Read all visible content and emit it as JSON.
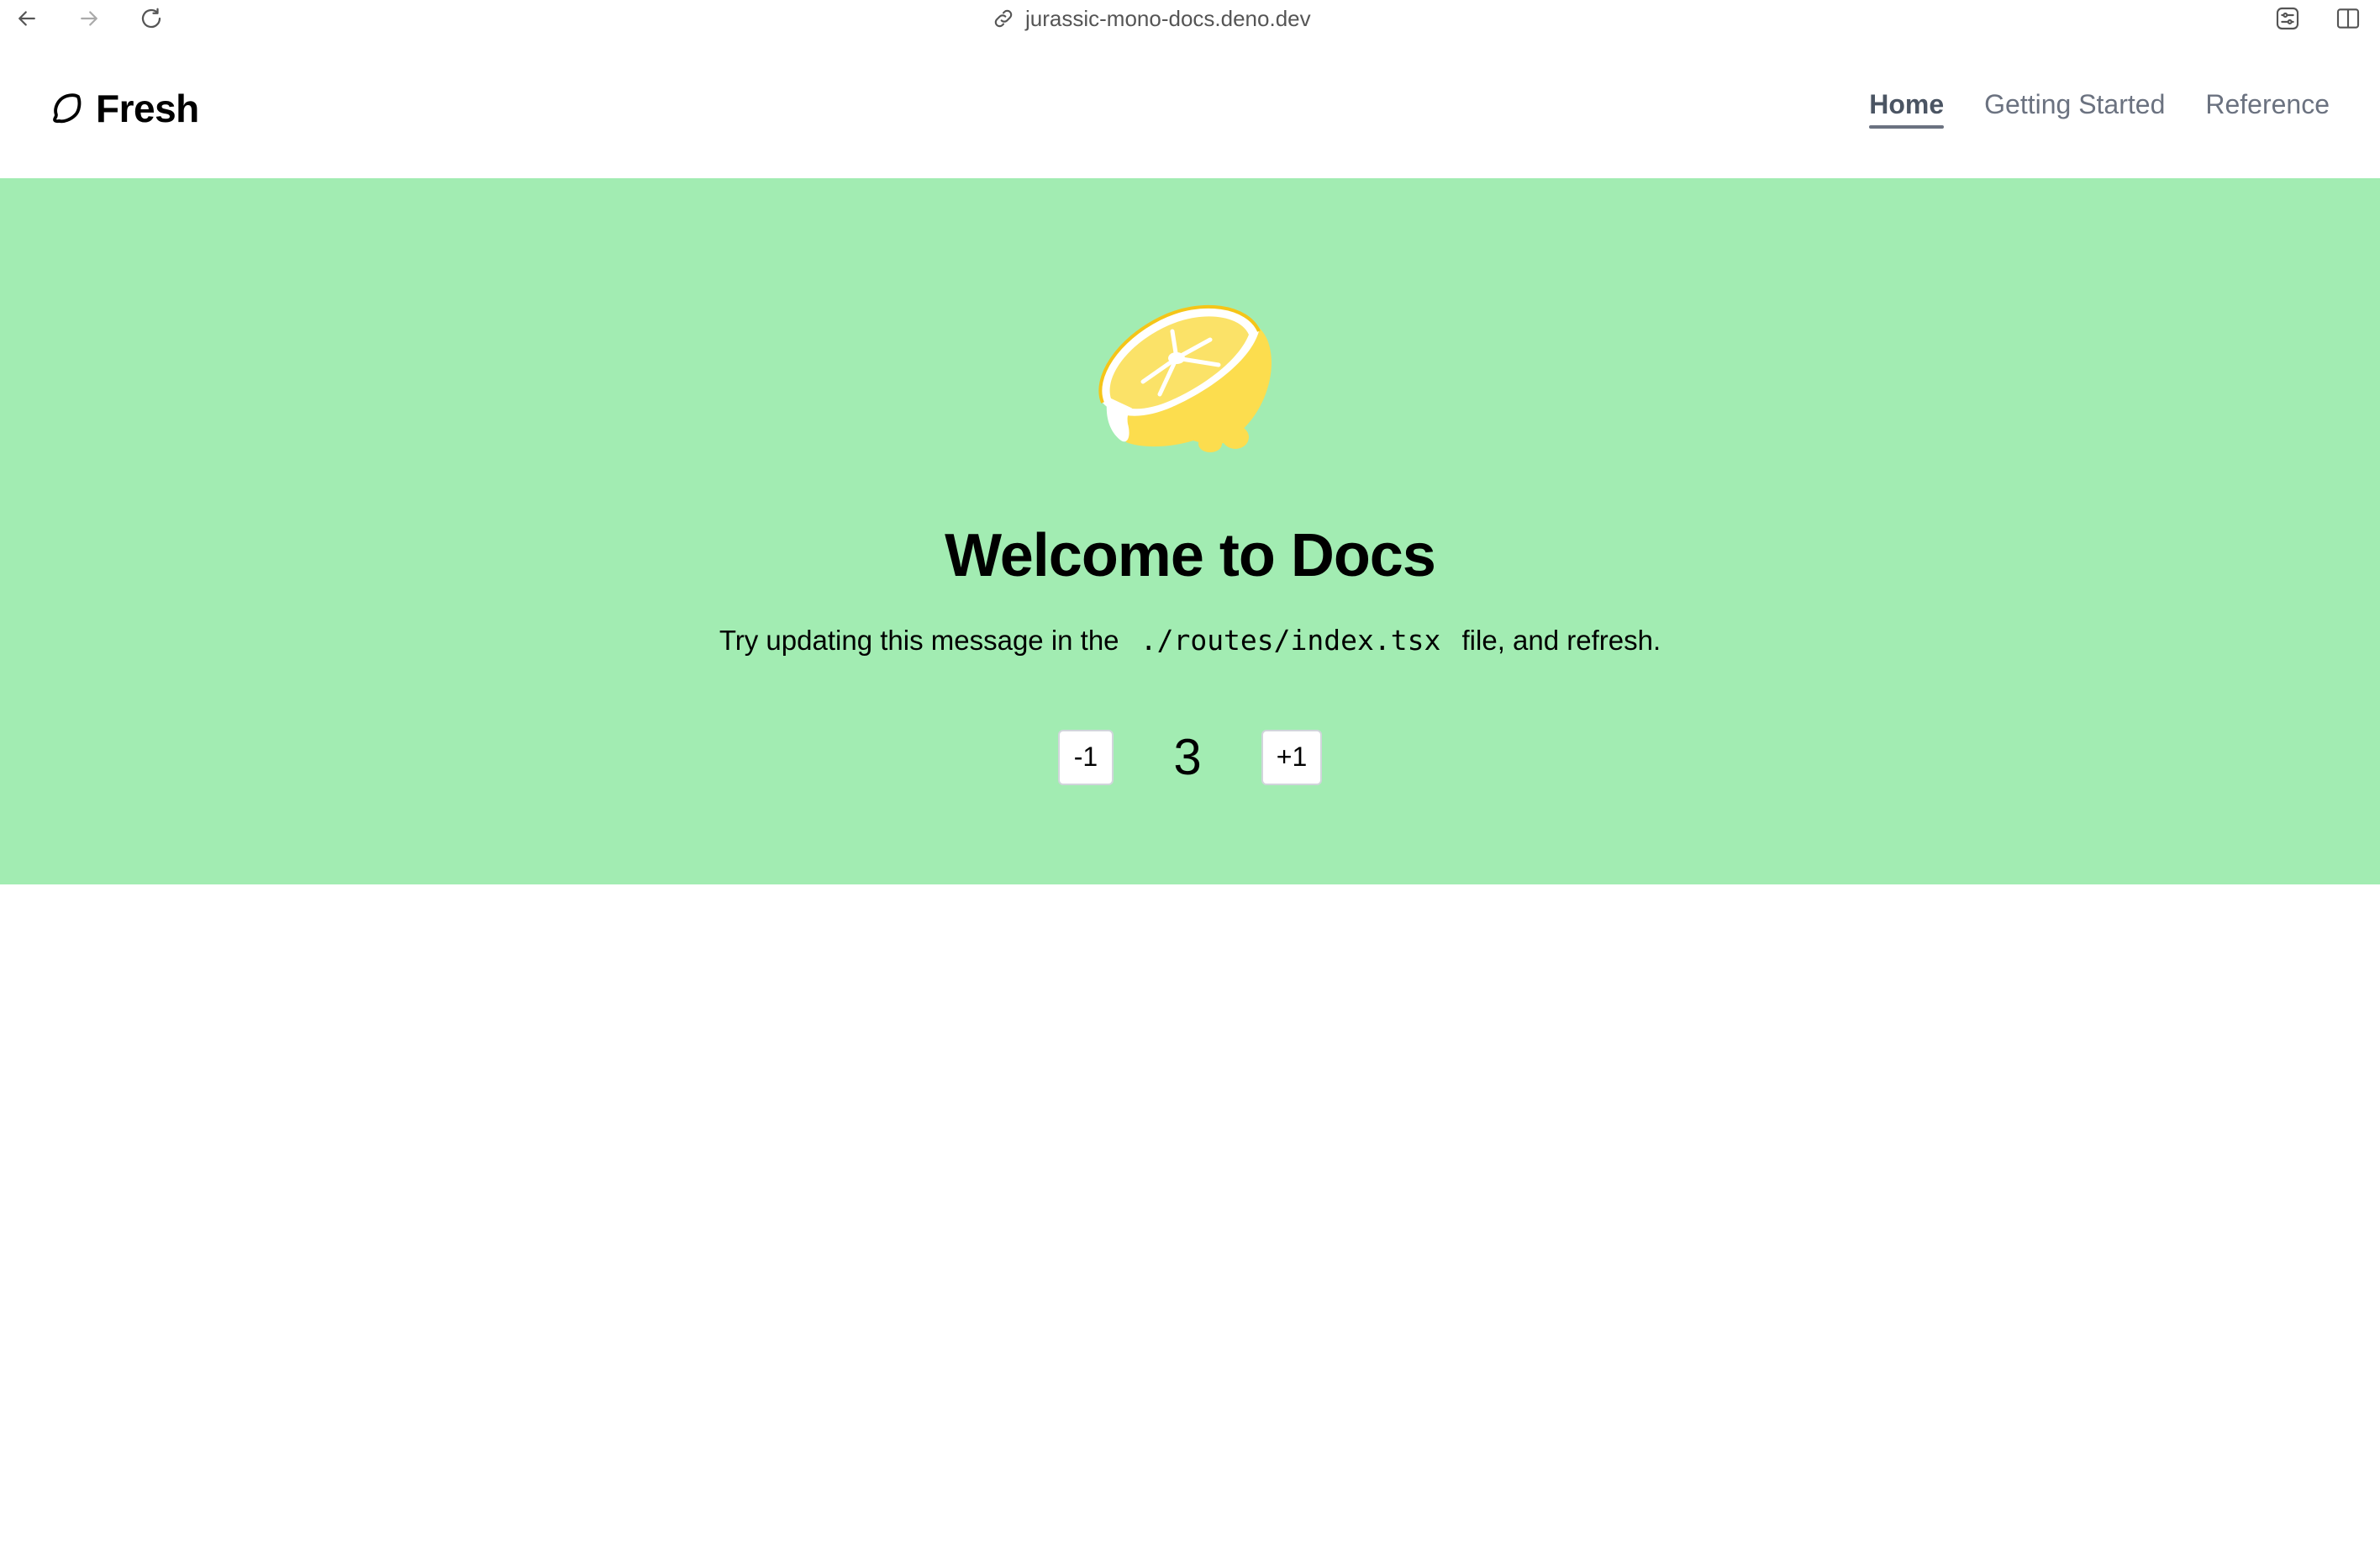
{
  "browser": {
    "url": "jurassic-mono-docs.deno.dev"
  },
  "header": {
    "brand": "Fresh",
    "nav": [
      {
        "label": "Home",
        "active": true
      },
      {
        "label": "Getting Started",
        "active": false
      },
      {
        "label": "Reference",
        "active": false
      }
    ]
  },
  "hero": {
    "background": "#a2ecb2",
    "logo_icon": "lemon-logo-icon",
    "title": "Welcome to Docs",
    "subtitle_before": "Try updating this message in the",
    "subtitle_code": "./routes/index.tsx",
    "subtitle_after": "file, and refresh.",
    "counter": {
      "decrement_label": "-1",
      "value": "3",
      "increment_label": "+1"
    }
  }
}
